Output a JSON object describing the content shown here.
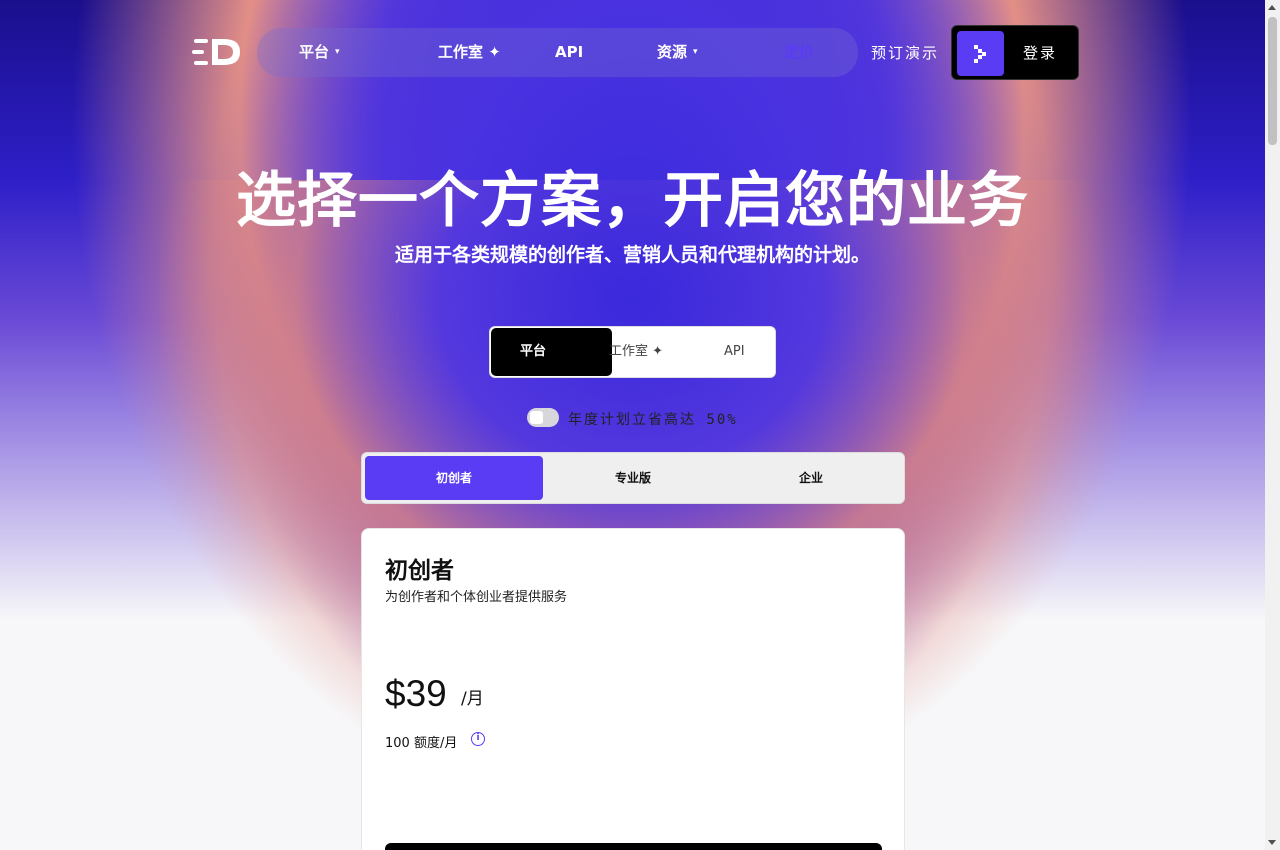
{
  "nav": {
    "items": [
      {
        "label": "平台",
        "has_caret": true
      },
      {
        "label": "工作室 ✦",
        "has_caret": false
      },
      {
        "label": "API",
        "has_caret": false
      },
      {
        "label": "资源",
        "has_caret": true
      },
      {
        "label": "定价",
        "has_caret": false,
        "active": true
      }
    ],
    "demo_label": "预订演示",
    "login_label": "登录"
  },
  "hero": {
    "title": "选择一个方案，开启您的业务",
    "subtitle": "适用于各类规模的创作者、营销人员和代理机构的计划。"
  },
  "product_tabs": {
    "items": [
      "平台",
      "工作室 ✦",
      "API"
    ],
    "selected": "平台"
  },
  "billing_toggle": {
    "label": "年度计划立省高达 50%",
    "on": false
  },
  "plan_tabs": {
    "items": [
      "初创者",
      "专业版",
      "企业"
    ],
    "selected": "初创者"
  },
  "plan_card": {
    "name": "初创者",
    "description": "为创作者和个体创业者提供服务",
    "price": "$39",
    "period": "/月",
    "credits": "100 额度/月",
    "info_icon": "i"
  },
  "colors": {
    "accent": "#5b3cf5",
    "dark": "#000000",
    "nav_text": "#ffffff"
  },
  "icons": {
    "logo": "brand-logo-icon",
    "login": "chevron-right-icon",
    "caret": "chevron-down-icon",
    "info": "info-icon"
  }
}
